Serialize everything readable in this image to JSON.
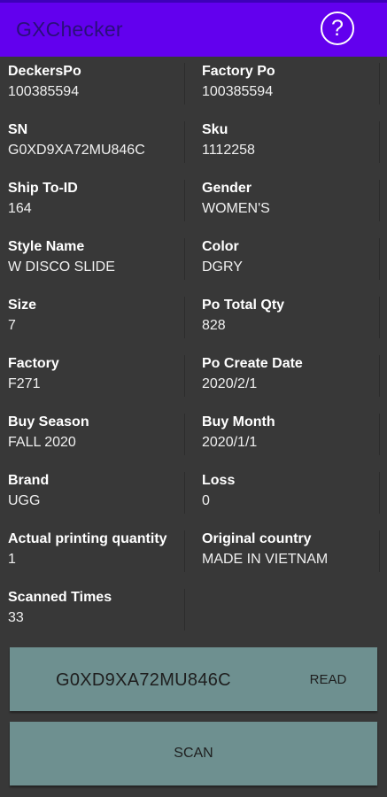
{
  "header": {
    "title": "GXChecker",
    "help_icon": "?"
  },
  "fields": [
    {
      "left": {
        "label": "DeckersPo",
        "value": "100385594"
      },
      "right": {
        "label": "Factory Po",
        "value": "100385594"
      }
    },
    {
      "left": {
        "label": "SN",
        "value": "G0XD9XA72MU846C"
      },
      "right": {
        "label": "Sku",
        "value": "1112258"
      }
    },
    {
      "left": {
        "label": "Ship To-ID",
        "value": "164"
      },
      "right": {
        "label": "Gender",
        "value": "WOMEN'S"
      }
    },
    {
      "left": {
        "label": "Style Name",
        "value": "W DISCO SLIDE"
      },
      "right": {
        "label": "Color",
        "value": "DGRY"
      }
    },
    {
      "left": {
        "label": "Size",
        "value": "7"
      },
      "right": {
        "label": "Po Total Qty",
        "value": "828"
      }
    },
    {
      "left": {
        "label": "Factory",
        "value": "F271"
      },
      "right": {
        "label": "Po Create Date",
        "value": "2020/2/1"
      }
    },
    {
      "left": {
        "label": "Buy Season",
        "value": "FALL 2020"
      },
      "right": {
        "label": "Buy Month",
        "value": "2020/1/1"
      }
    },
    {
      "left": {
        "label": "Brand",
        "value": "UGG"
      },
      "right": {
        "label": "Loss",
        "value": "0"
      }
    },
    {
      "left": {
        "label": "Actual printing quantity",
        "value": "1"
      },
      "right": {
        "label": "Original country",
        "value": "MADE IN VIETNAM"
      }
    },
    {
      "left": {
        "label": "Scanned Times",
        "value": "33"
      },
      "right": {
        "label": "",
        "value": ""
      }
    }
  ],
  "serial_input": {
    "value": "G0XD9XA72MU846C",
    "read_label": "READ"
  },
  "scan_button": {
    "label": "SCAN"
  },
  "colors": {
    "app_bar": "#6200ee",
    "background": "#383838",
    "button": "#6e9090"
  }
}
